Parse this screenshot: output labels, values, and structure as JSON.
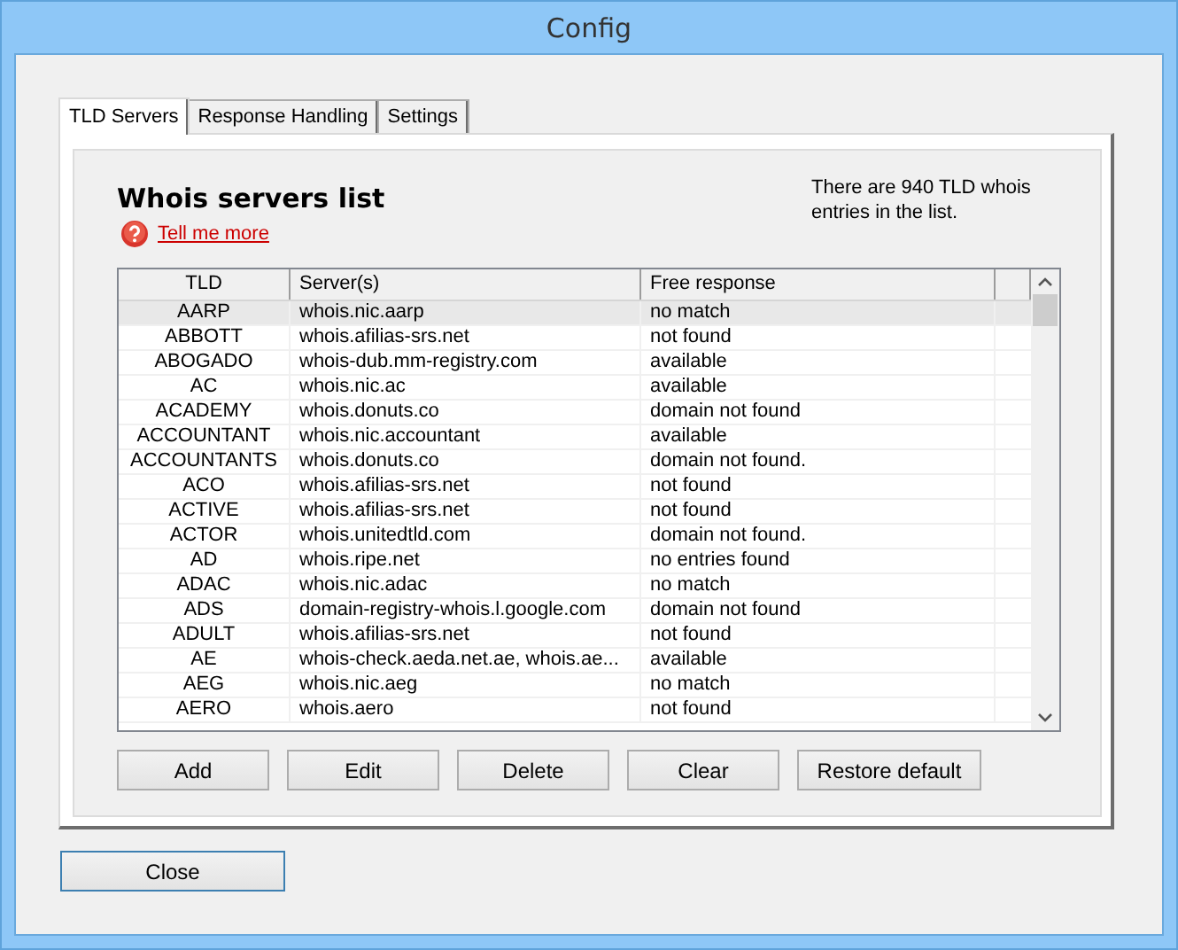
{
  "window": {
    "title": "Config"
  },
  "tabs": [
    {
      "label": "TLD Servers",
      "selected": true
    },
    {
      "label": "Response Handling",
      "selected": false
    },
    {
      "label": "Settings",
      "selected": false
    }
  ],
  "heading": "Whois servers list",
  "help_link": "Tell me more",
  "summary": "There are 940 TLD whois entries in the list.",
  "table": {
    "columns": [
      "TLD",
      "Server(s)",
      "Free response"
    ],
    "rows": [
      {
        "cells": [
          "AARP",
          "whois.nic.aarp",
          "no match"
        ],
        "selected": true
      },
      {
        "cells": [
          "ABBOTT",
          "whois.afilias-srs.net",
          "not found"
        ],
        "selected": false
      },
      {
        "cells": [
          "ABOGADO",
          "whois-dub.mm-registry.com",
          "available"
        ],
        "selected": false
      },
      {
        "cells": [
          "AC",
          "whois.nic.ac",
          "available"
        ],
        "selected": false
      },
      {
        "cells": [
          "ACADEMY",
          "whois.donuts.co",
          "domain not found"
        ],
        "selected": false
      },
      {
        "cells": [
          "ACCOUNTANT",
          "whois.nic.accountant",
          "available"
        ],
        "selected": false
      },
      {
        "cells": [
          "ACCOUNTANTS",
          "whois.donuts.co",
          "domain not found."
        ],
        "selected": false
      },
      {
        "cells": [
          "ACO",
          "whois.afilias-srs.net",
          "not found"
        ],
        "selected": false
      },
      {
        "cells": [
          "ACTIVE",
          "whois.afilias-srs.net",
          "not found"
        ],
        "selected": false
      },
      {
        "cells": [
          "ACTOR",
          "whois.unitedtld.com",
          "domain not found."
        ],
        "selected": false
      },
      {
        "cells": [
          "AD",
          "whois.ripe.net",
          "no entries found"
        ],
        "selected": false
      },
      {
        "cells": [
          "ADAC",
          "whois.nic.adac",
          "no match"
        ],
        "selected": false
      },
      {
        "cells": [
          "ADS",
          "domain-registry-whois.l.google.com",
          "domain not found"
        ],
        "selected": false
      },
      {
        "cells": [
          "ADULT",
          "whois.afilias-srs.net",
          "not found"
        ],
        "selected": false
      },
      {
        "cells": [
          "AE",
          "whois-check.aeda.net.ae, whois.ae...",
          "available"
        ],
        "selected": false
      },
      {
        "cells": [
          "AEG",
          "whois.nic.aeg",
          "no match"
        ],
        "selected": false
      },
      {
        "cells": [
          "AERO",
          "whois.aero",
          "not found"
        ],
        "selected": false
      }
    ]
  },
  "buttons": [
    "Add",
    "Edit",
    "Delete",
    "Clear",
    "Restore default"
  ],
  "close_button": "Close"
}
